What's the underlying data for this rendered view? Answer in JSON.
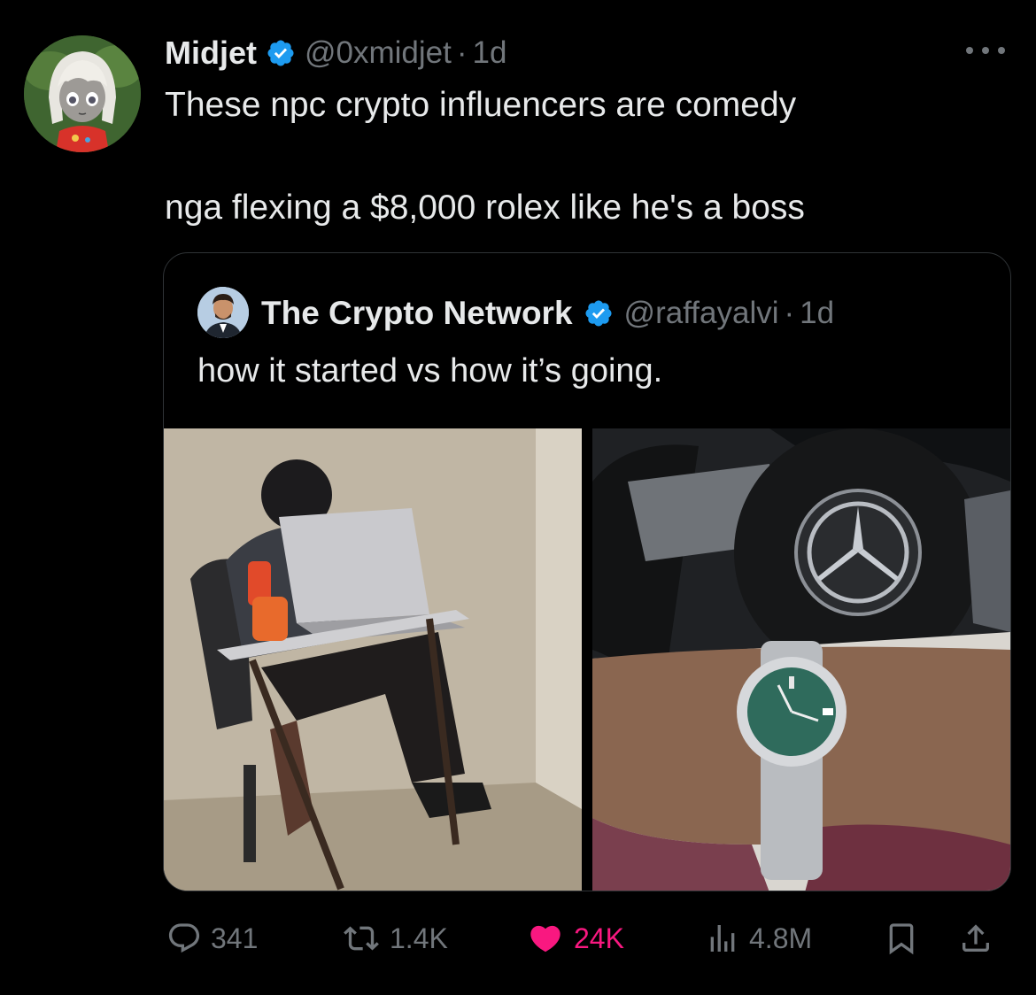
{
  "author": {
    "name": "Midjet",
    "handle": "@0xmidjet",
    "time": "1d"
  },
  "tweet": {
    "line1": "These npc crypto influencers are comedy",
    "line2": "nga flexing a $8,000 rolex like he's a boss"
  },
  "quoted": {
    "name": "The Crypto Network",
    "handle": "@raffayalvi",
    "time": "1d",
    "text": "how it started vs how it’s going."
  },
  "metrics": {
    "replies": "341",
    "retweets": "1.4K",
    "likes": "24K",
    "views": "4.8M"
  },
  "colors": {
    "background": "#000000",
    "text": "#e7e9ea",
    "muted": "#71767b",
    "verified": "#1d9bf0",
    "like": "#f91880",
    "border": "#2f3336"
  },
  "icons": {
    "reply": "speech-bubble-icon",
    "retweet": "retweet-arrows-icon",
    "like": "heart-filled-icon",
    "views": "bar-chart-icon",
    "bookmark": "bookmark-icon",
    "share": "share-upload-icon",
    "more": "ellipsis-icon"
  }
}
